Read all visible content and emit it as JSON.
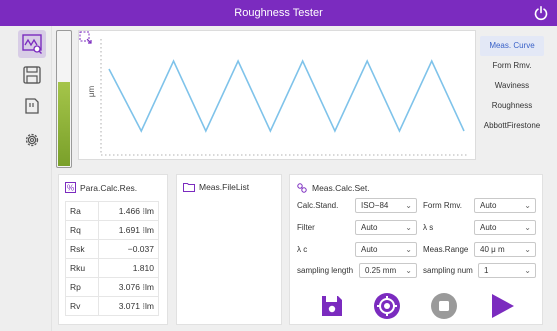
{
  "app": {
    "title": "Roughness Tester"
  },
  "sidebar": {
    "items": [
      {
        "name": "curve-view-icon",
        "active": true
      },
      {
        "name": "save-disk-icon",
        "active": false
      },
      {
        "name": "memory-card-icon",
        "active": false
      },
      {
        "name": "settings-gear-icon",
        "active": false
      }
    ]
  },
  "gauge": {
    "level": 0.62,
    "color": "#8db43a"
  },
  "graph": {
    "ylabel": "μm",
    "chart_data": {
      "type": "line",
      "waveform": "triangle",
      "cycles": 5.5,
      "amplitude_relative": 1.0
    }
  },
  "modes": [
    {
      "label": "Meas. Curve",
      "active": true
    },
    {
      "label": "Form Rmv.",
      "active": false
    },
    {
      "label": "Waviness",
      "active": false
    },
    {
      "label": "Roughness",
      "active": false
    },
    {
      "label": "AbbottFirestone",
      "active": false
    }
  ],
  "params": {
    "title": "Para.Calc.Res.",
    "rows": [
      {
        "name": "Ra",
        "value": "1.466 ⁝lm"
      },
      {
        "name": "Rq",
        "value": "1.691 ⁝lm"
      },
      {
        "name": "Rsk",
        "value": "−0.037"
      },
      {
        "name": "Rku",
        "value": "1.810"
      },
      {
        "name": "Rp",
        "value": "3.076 ⁝lm"
      },
      {
        "name": "Rv",
        "value": "3.071 ⁝lm"
      }
    ]
  },
  "filelist": {
    "title": "Meas.FileList"
  },
  "settings": {
    "title": "Meas.Calc.Set.",
    "calc_standard": {
      "label": "Calc.Stand.",
      "value": "ISO−84"
    },
    "form_rmv": {
      "label": "Form Rmv.",
      "value": "Auto"
    },
    "filter": {
      "label": "Filter",
      "value": "Auto"
    },
    "lambda_s": {
      "label": "λ s",
      "value": "Auto"
    },
    "lambda_c": {
      "label": "λ c",
      "value": "Auto"
    },
    "meas_range": {
      "label": "Meas.Range",
      "value": "40 μ m"
    },
    "sampling_length": {
      "label": "sampling length",
      "value": "0.25 mm"
    },
    "sampling_num": {
      "label": "sampling num",
      "value": "1"
    }
  },
  "colors": {
    "accent": "#7b2bbf",
    "button_gray": "#9a9a9a",
    "wave": "#7fc3ea"
  }
}
